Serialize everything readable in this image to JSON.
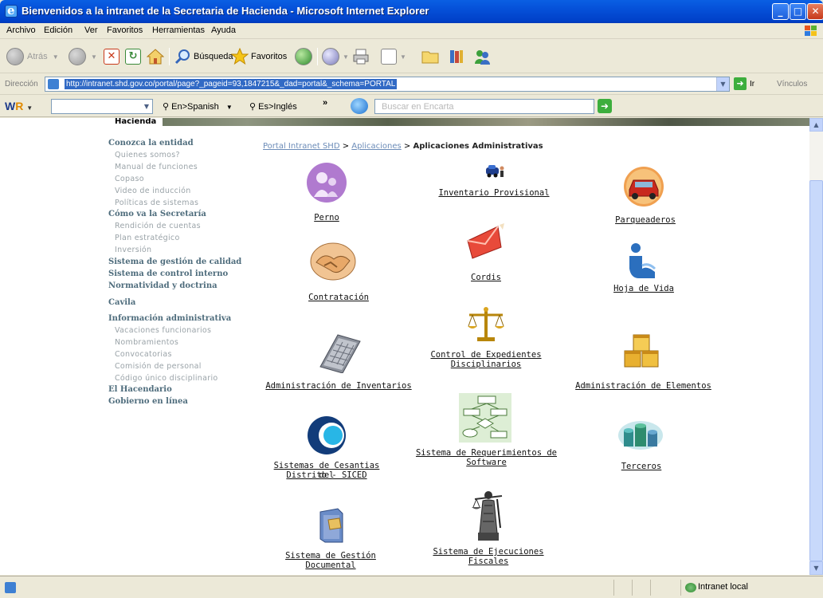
{
  "window": {
    "title": "Bienvenidos a la intranet de la Secretaria de Hacienda - Microsoft Internet Explorer",
    "min": "_",
    "max": "□",
    "close": "✕"
  },
  "menu": [
    "Archivo",
    "Edición",
    "Ver",
    "Favoritos",
    "Herramientas",
    "Ayuda"
  ],
  "toolbar": {
    "back": "Atrás",
    "search": "Búsqueda",
    "favorites": "Favoritos"
  },
  "address": {
    "label": "Dirección",
    "url": "http://intranet.shd.gov.co/portal/page?_pageid=93,1847215&_dad=portal&_schema=PORTAL",
    "go": "Ir",
    "links": "Vínculos"
  },
  "wrbar": {
    "logo_w": "W",
    "logo_r": "R",
    "en_es": "En>Spanish",
    "es_en": "Es>Inglés",
    "encarta_placeholder": "Buscar en Encarta"
  },
  "banner": {
    "label": "Hacienda"
  },
  "sidebar": {
    "items": [
      {
        "label": "Conozca la entidad",
        "type": "h"
      },
      {
        "label": "Quienes somos?",
        "type": "s"
      },
      {
        "label": "Manual de funciones",
        "type": "s"
      },
      {
        "label": "Copaso",
        "type": "s"
      },
      {
        "label": "Video de inducción",
        "type": "s"
      },
      {
        "label": "Políticas de sistemas",
        "type": "s"
      },
      {
        "label": "Cómo va la Secretaría",
        "type": "h"
      },
      {
        "label": "Rendición de cuentas",
        "type": "s"
      },
      {
        "label": "Plan estratégico",
        "type": "s"
      },
      {
        "label": "Inversión",
        "type": "s"
      },
      {
        "label": "Sistema de gestión de calidad",
        "type": "h"
      },
      {
        "label": "Sistema de control interno",
        "type": "h"
      },
      {
        "label": "Normatividad y doctrina",
        "type": "h"
      },
      {
        "label": "Cavila",
        "type": "h"
      },
      {
        "label": "Información administrativa",
        "type": "h"
      },
      {
        "label": "Vacaciones funcionarios",
        "type": "s"
      },
      {
        "label": "Nombramientos",
        "type": "s"
      },
      {
        "label": "Convocatorias",
        "type": "s"
      },
      {
        "label": "Comisión de personal",
        "type": "s"
      },
      {
        "label": "Código único disciplinario",
        "type": "s"
      },
      {
        "label": "El Hacendario",
        "type": "h"
      },
      {
        "label": "Gobierno en línea",
        "type": "h"
      }
    ]
  },
  "breadcrumb": {
    "home": "Portal Intranet SHD",
    "sep1": " > ",
    "section": "Aplicaciones",
    "sep2": " > ",
    "current": "Aplicaciones Administrativas"
  },
  "apps": {
    "perno": "Perno",
    "inventario": "Inventario Provisional",
    "parqueaderos": "Parqueaderos",
    "contratacion": "Contratación",
    "cordis": "Cordis",
    "hoja_vida": "Hoja de Vida",
    "admin_inv": "Administración de Inventarios",
    "control_exp_1": "Control de Expedientes",
    "control_exp_2": "Disciplinarios",
    "admin_elem": "Administración de Elementos",
    "siced_1": "Sistemas de Cesantias del",
    "siced_2": "Distrito - SICED",
    "req_soft_1": "Sistema de Requerimientos de",
    "req_soft_2": "Software",
    "terceros": "Terceros",
    "gestion_doc_1": "Sistema de Gestión",
    "gestion_doc_2": "Documental",
    "ejec_fisc_1": "Sistema de Ejecuciones",
    "ejec_fisc_2": "Fiscales"
  },
  "status": {
    "zone": "Intranet local"
  }
}
